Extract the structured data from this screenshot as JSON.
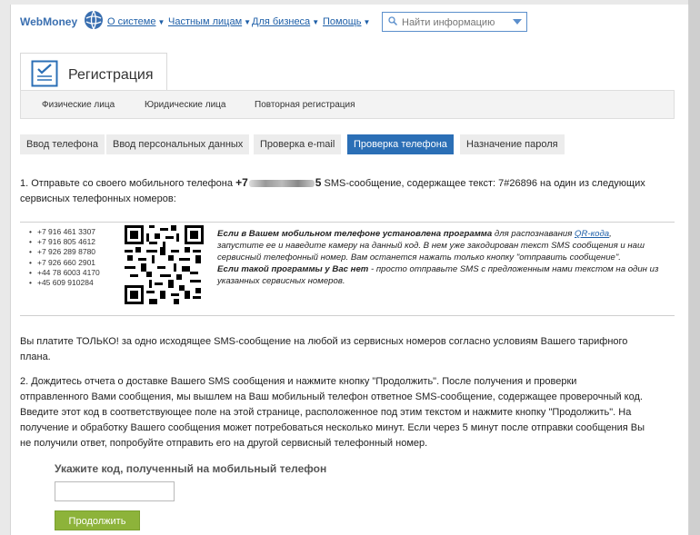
{
  "header": {
    "logo_text": "WebMoney",
    "nav": [
      {
        "label": "О системе"
      },
      {
        "label": "Частным лицам"
      },
      {
        "label": "Для бизнеса"
      },
      {
        "label": "Помощь"
      }
    ],
    "search": {
      "placeholder": "Найти информацию"
    }
  },
  "registration": {
    "title": "Регистрация",
    "subnav": [
      "Физические лица",
      "Юридические лица",
      "Повторная регистрация"
    ]
  },
  "steps": [
    {
      "label": "Ввод телефона",
      "active": false
    },
    {
      "label": "Ввод персональных данных",
      "active": false
    },
    {
      "label": "Проверка e-mail",
      "active": false
    },
    {
      "label": "Проверка телефона",
      "active": true
    },
    {
      "label": "Назначение пароля",
      "active": false
    }
  ],
  "instruction1": {
    "before": "1. Отправьте со своего мобильного телефона",
    "phone_prefix": "+7",
    "phone_suffix": "5",
    "after_line1": "SMS-сообщение, содержащее текст: 7#26896 на один из следующих",
    "line2": "сервисных телефонных номеров:"
  },
  "service_numbers": [
    "+7 916 461 3307",
    "+7 916 805 4612",
    "+7 926 289 8780",
    "+7 926 660 2901",
    "+44 78 6003 4170",
    "+45 609 910284"
  ],
  "qr_info": {
    "bold1": "Если в Вашем мобильном телефоне установлена программа",
    "text1a": "для распознавания",
    "link": "QR-кода",
    "text1b": ",",
    "line2": "запустите ее и наведите камеру на данный код. В нем уже закодирован текст SMS сообщения и наш",
    "line3": "сервисный телефонный номер. Вам останется нажать только кнопку \"отправить сообщение\".",
    "bold2": "Если такой программы у Вас нет",
    "text2": "- просто отправьте SMS с предложенным нами текстом на один из",
    "line5": "указанных сервисных номеров."
  },
  "payment_note": [
    "Вы платите ТОЛЬКО! за одно исходящее SMS-сообщение на любой из сервисных номеров согласно условиям Вашего тарифного",
    "плана."
  ],
  "instruction2": [
    "2. Дождитесь отчета о доставке Вашего SMS сообщения и нажмите кнопку \"Продолжить\". После получения и проверки",
    "отправленного Вами сообщения, мы вышлем на Ваш мобильный телефон ответное SMS-сообщение, содержащее проверочный код.",
    "Введите этот код в соответствующее поле на этой странице, расположенное под этим текстом и нажмите кнопку \"Продолжить\". На",
    "получение и обработку Вашего сообщения может потребоваться несколько минут. Если через 5 минут после отправки сообщения Вы",
    "не получили ответ, попробуйте отправить его на другой сервисный телефонный номер."
  ],
  "code_form": {
    "label": "Укажите код, полученный на мобильный телефон",
    "value": "",
    "submit_label": "Продолжить"
  },
  "colors": {
    "accent": "#2b6fb6",
    "link": "#1e5fa8",
    "button": "#8db33a"
  }
}
